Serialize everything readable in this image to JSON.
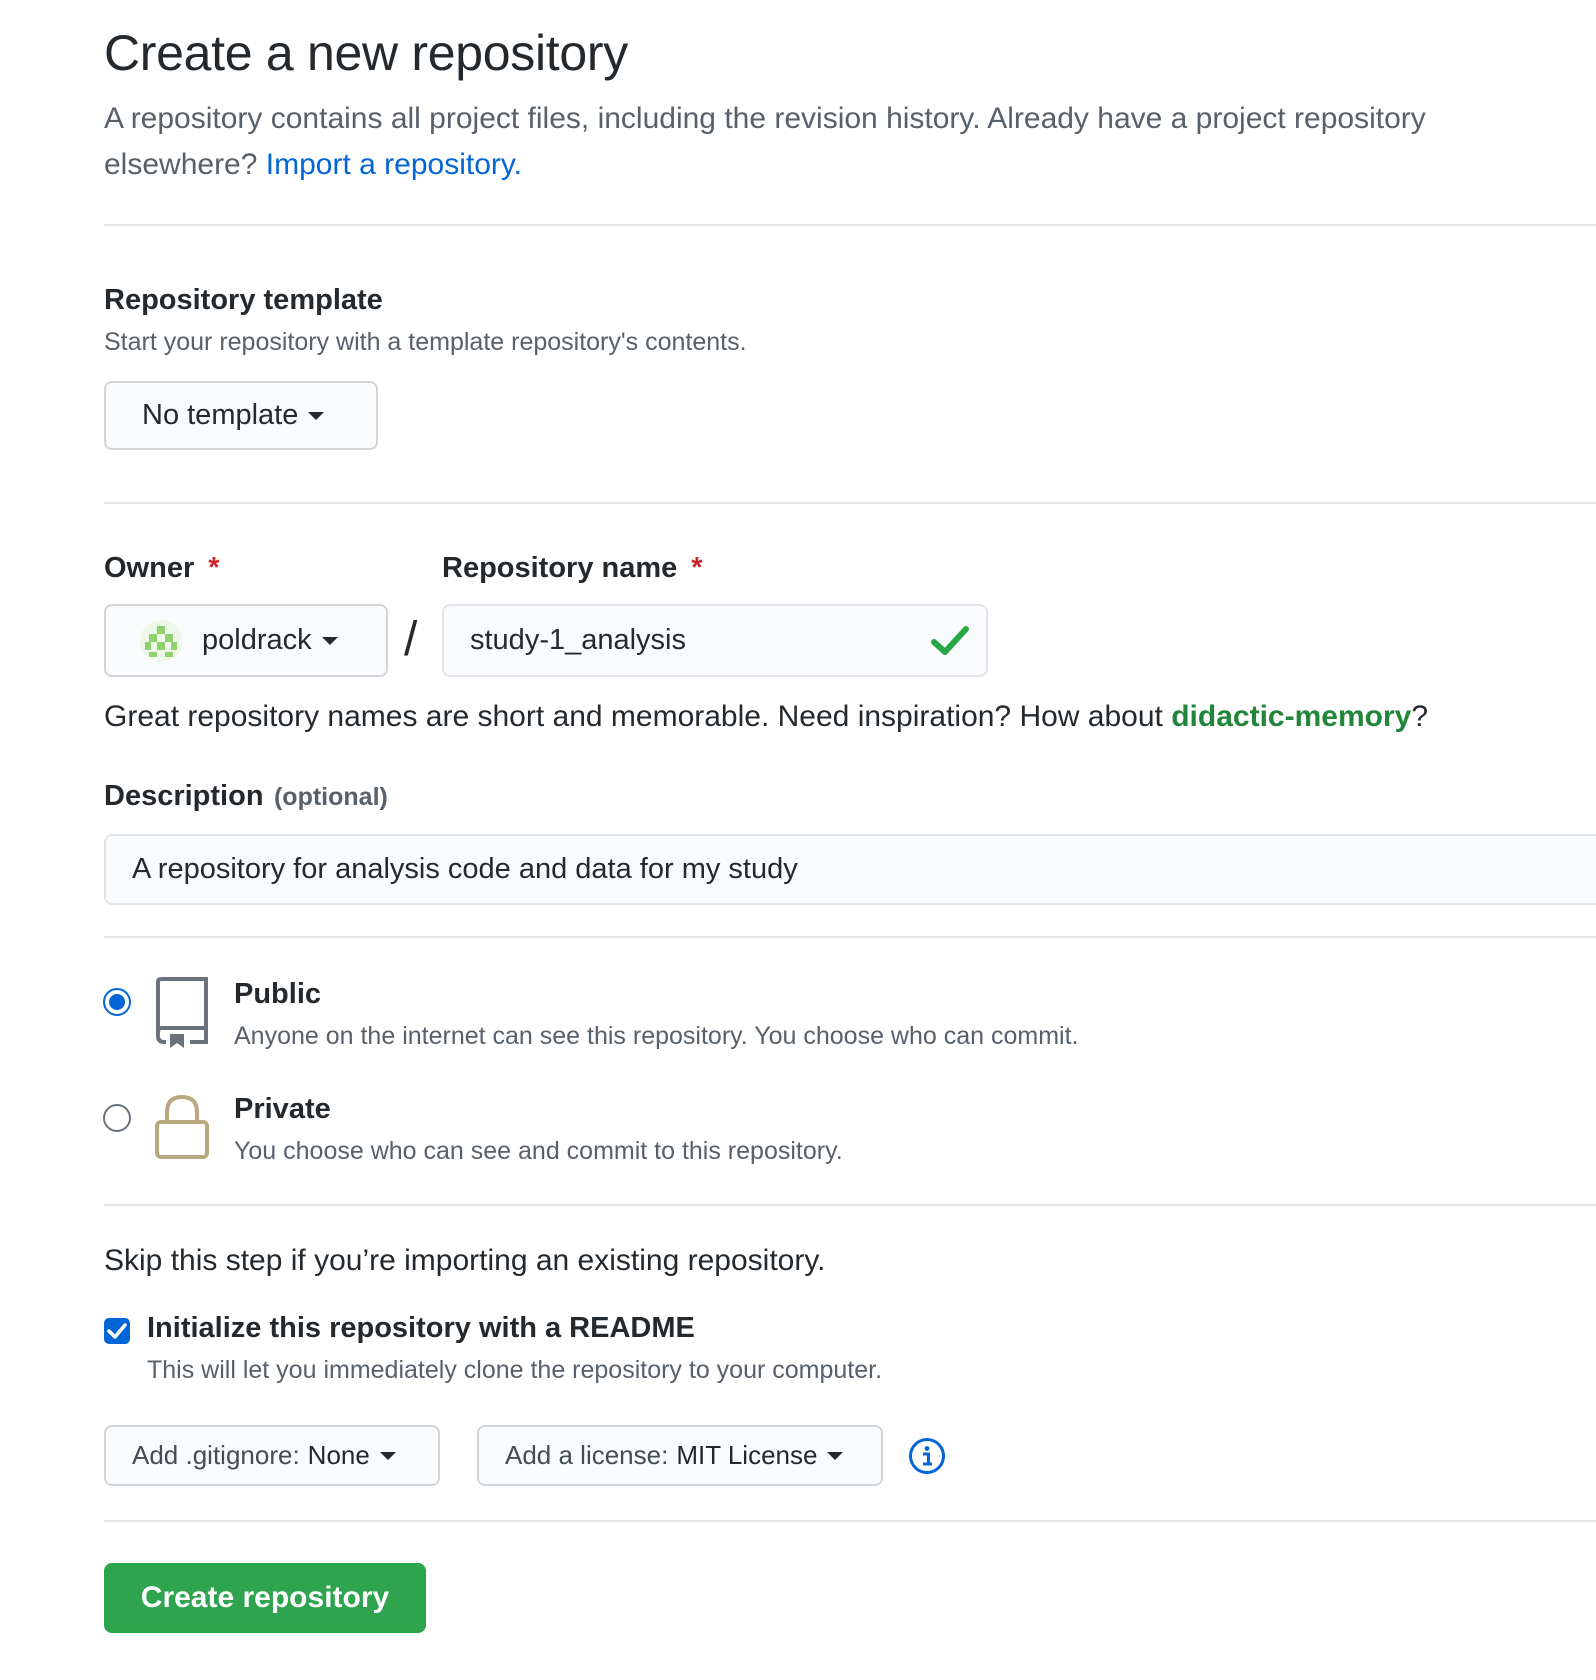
{
  "header": {
    "title": "Create a new repository",
    "intro_text": "A repository contains all project files, including the revision history. Already have a project repository elsewhere?",
    "import_link": "Import a repository."
  },
  "template": {
    "label": "Repository template",
    "note": "Start your repository with a template repository's contents.",
    "selected": "No template"
  },
  "owner": {
    "label": "Owner",
    "required_mark": "*",
    "value": "poldrack"
  },
  "separator": "/",
  "repo_name": {
    "label": "Repository name",
    "required_mark": "*",
    "value": "study-1_analysis",
    "valid_icon": "check-icon"
  },
  "name_hint": {
    "text": "Great repository names are short and memorable. Need inspiration? How about",
    "suggestion": "didactic-memory",
    "suffix": "?"
  },
  "description": {
    "label": "Description",
    "optional": "(optional)",
    "value": "A repository for analysis code and data for my study"
  },
  "visibility": {
    "selected": "public",
    "options": [
      {
        "key": "public",
        "title": "Public",
        "desc": "Anyone on the internet can see this repository. You choose who can commit.",
        "icon": "repo-book-icon"
      },
      {
        "key": "private",
        "title": "Private",
        "desc": "You choose who can see and commit to this repository.",
        "icon": "lock-icon"
      }
    ]
  },
  "init": {
    "skip_note": "Skip this step if you’re importing an existing repository.",
    "readme_checked": true,
    "readme_label": "Initialize this repository with a README",
    "readme_desc": "This will let you immediately clone the repository to your computer."
  },
  "gitignore": {
    "prefix": "Add .gitignore:",
    "value": "None"
  },
  "license": {
    "prefix": "Add a license:",
    "value": "MIT License",
    "info_icon": "info-icon"
  },
  "submit": {
    "label": "Create repository"
  },
  "colors": {
    "primary": "#2ea44f",
    "link": "#0366d6",
    "suggestion": "#22863a",
    "required": "#cb2431"
  }
}
